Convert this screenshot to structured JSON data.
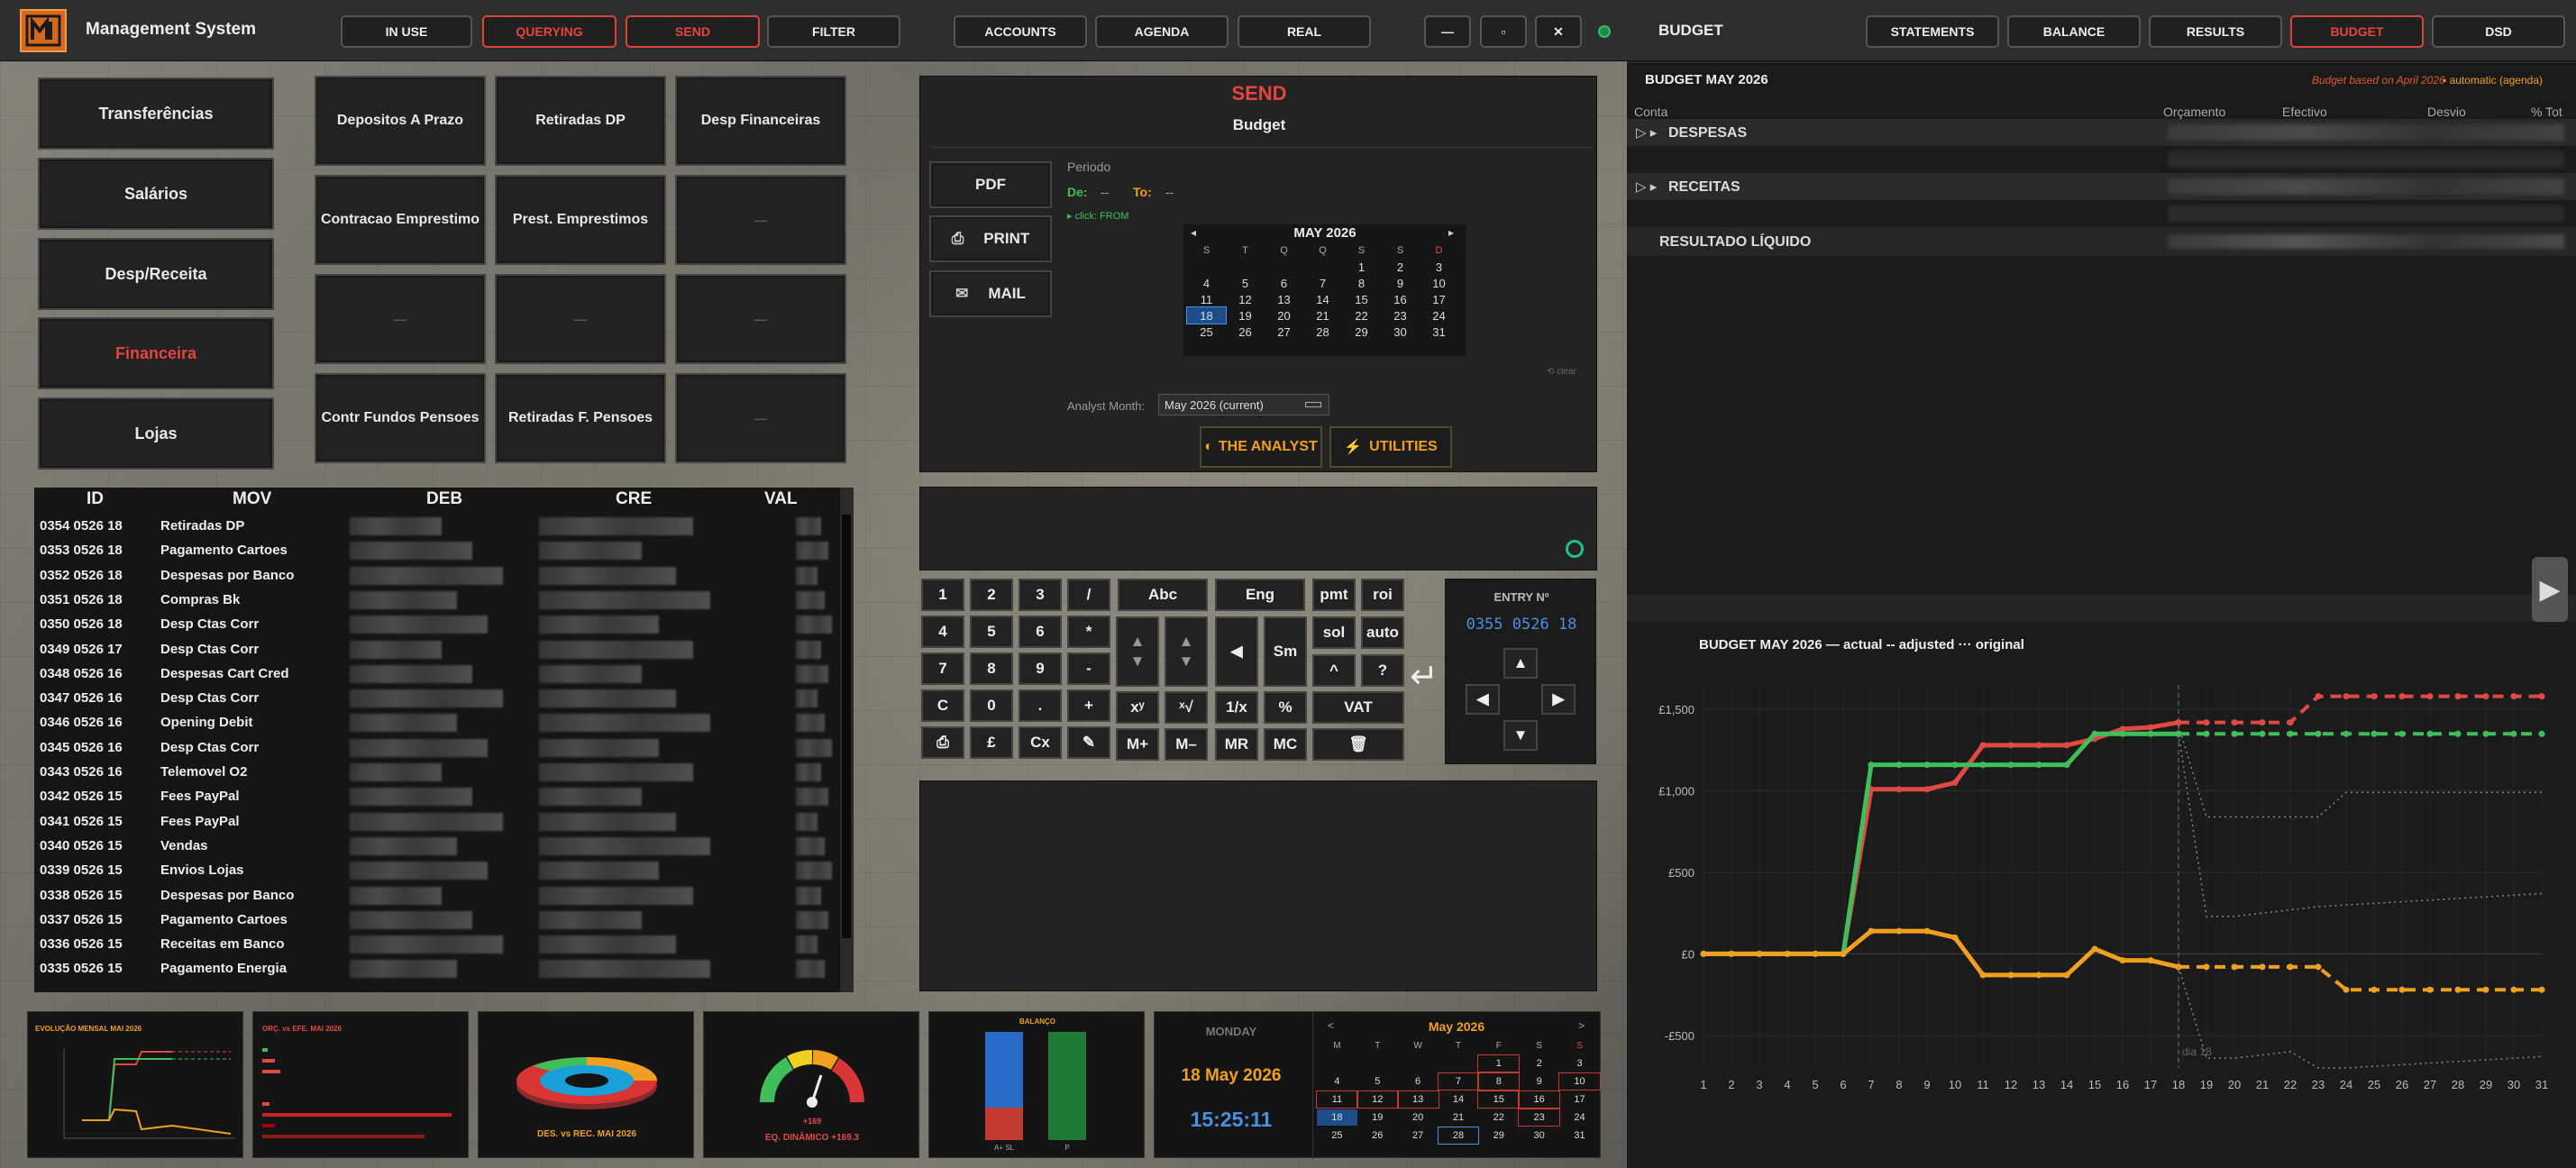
{
  "app": {
    "title": "Management System"
  },
  "toolbar": {
    "buttons": [
      "IN USE",
      "QUERYING",
      "SEND",
      "FILTER",
      "ACCOUNTS",
      "AGENDA",
      "REAL"
    ],
    "active": [
      "QUERYING",
      "SEND"
    ],
    "window": {
      "min": "—",
      "max": "▫",
      "close": "✕"
    }
  },
  "right_nav": {
    "title": "BUDGET",
    "tabs": [
      "STATEMENTS",
      "BALANCE",
      "RESULTS",
      "BUDGET",
      "DSD"
    ],
    "active": "BUDGET"
  },
  "left_menu": [
    "Transferências",
    "Salários",
    "Desp/Receita",
    "Financeira",
    "Lojas"
  ],
  "left_menu_active": "Financeira",
  "grid_tiles": [
    [
      "Depositos A Prazo",
      "Retiradas DP",
      "Desp Financeiras"
    ],
    [
      "Contracao Emprestimo",
      "Prest. Emprestimos",
      "—"
    ],
    [
      "—",
      "—",
      "—"
    ],
    [
      "Contr Fundos Pensoes",
      "Retiradas F. Pensoes",
      "—"
    ]
  ],
  "send": {
    "title": "SEND",
    "subtitle": "Budget",
    "pdf": "PDF",
    "print": "PRINT",
    "mail": "MAIL",
    "periodo_label": "Periodo",
    "de_label": "De:",
    "de_val": "--",
    "to_label": "To:",
    "to_val": "--",
    "hint": "▸ click: FROM",
    "clear": "⟲ clear",
    "analyst_label": "Analyst Month:",
    "analyst_value": "May 2026 (current)",
    "analyst_btn": "THE ANALYST",
    "utilities_btn": "UTILITIES"
  },
  "mini_cal": {
    "title": "MAY 2026",
    "days": [
      "S",
      "T",
      "Q",
      "Q",
      "S",
      "S",
      "D"
    ],
    "weeks": [
      [
        "",
        "",
        "",
        "",
        "1",
        "2",
        "3"
      ],
      [
        "4",
        "5",
        "6",
        "7",
        "8",
        "9",
        "10"
      ],
      [
        "11",
        "12",
        "13",
        "14",
        "15",
        "16",
        "17"
      ],
      [
        "18",
        "19",
        "20",
        "21",
        "22",
        "23",
        "24"
      ],
      [
        "25",
        "26",
        "27",
        "28",
        "29",
        "30",
        "31"
      ]
    ],
    "today": "18"
  },
  "table": {
    "headers": [
      "ID",
      "MOV",
      "DEB",
      "CRE",
      "VAL"
    ],
    "rows": [
      [
        "0354 0526 18",
        "Retiradas DP"
      ],
      [
        "0353 0526 18",
        "Pagamento Cartoes"
      ],
      [
        "0352 0526 18",
        "Despesas por Banco"
      ],
      [
        "0351 0526 18",
        "Compras Bk"
      ],
      [
        "0350 0526 18",
        "Desp Ctas Corr"
      ],
      [
        "0349 0526 17",
        "Desp Ctas Corr"
      ],
      [
        "0348 0526 16",
        "Despesas Cart Cred"
      ],
      [
        "0347 0526 16",
        "Desp Ctas Corr"
      ],
      [
        "0346 0526 16",
        "Opening Debit"
      ],
      [
        "0345 0526 16",
        "Desp Ctas Corr"
      ],
      [
        "0343 0526 16",
        "Telemovel O2"
      ],
      [
        "0342 0526 15",
        "Fees PayPal"
      ],
      [
        "0341 0526 15",
        "Fees PayPal"
      ],
      [
        "0340 0526 15",
        "Vendas"
      ],
      [
        "0339 0526 15",
        "Envios Lojas"
      ],
      [
        "0338 0526 15",
        "Despesas por Banco"
      ],
      [
        "0337 0526 15",
        "Pagamento Cartoes"
      ],
      [
        "0336 0526 15",
        "Receitas em Banco"
      ],
      [
        "0335 0526 15",
        "Pagamento Energia"
      ]
    ]
  },
  "keypad": {
    "rows": [
      [
        "1",
        "2",
        "3",
        "/"
      ],
      [
        "4",
        "5",
        "6",
        "*"
      ],
      [
        "7",
        "8",
        "9",
        "-"
      ],
      [
        "C",
        "0",
        ".",
        "+"
      ],
      [
        "⎙",
        "£",
        "Cx",
        "✎"
      ]
    ],
    "wide": [
      "Abc",
      "Eng"
    ],
    "fn": [
      [
        "pmt",
        "roi"
      ],
      [
        "sol",
        "auto"
      ],
      [
        "^",
        "?"
      ],
      [
        "%",
        ""
      ],
      [
        "MC",
        ""
      ]
    ],
    "misc": [
      "xʸ",
      "ˣ√",
      "1/x",
      "M+",
      "M–",
      "MR",
      "VAT",
      "Sm"
    ],
    "entry_label": "ENTRY Nº",
    "entry_value": "0355 0526 18"
  },
  "budget": {
    "title": "BUDGET  MAY 2026",
    "note": "Budget based on April 2026",
    "mode": "▪ automatic (agenda)",
    "cols": [
      "Conta",
      "Orçamento",
      "Efectivo",
      "Desvio",
      "% Tot"
    ],
    "rows": [
      "DESPESAS",
      "RECEITAS"
    ],
    "total": "RESULTADO LÍQUIDO"
  },
  "chart_data": {
    "type": "line",
    "title": "BUDGET  MAY 2026",
    "legend": [
      "— actual",
      "-- adjusted",
      "··· original"
    ],
    "x": [
      1,
      2,
      3,
      4,
      5,
      6,
      7,
      8,
      9,
      10,
      11,
      12,
      13,
      14,
      15,
      16,
      17,
      18,
      19,
      20,
      21,
      22,
      23,
      24,
      25,
      26,
      27,
      28,
      29,
      30,
      31
    ],
    "yticks": [
      "£1,500",
      "£1,000",
      "£500",
      "£0",
      "-£500"
    ],
    "ylim": [
      -700,
      1650
    ],
    "marker_label": "dia 18",
    "series": [
      {
        "name": "actual",
        "color": "#e04a45",
        "values": [
          0,
          0,
          0,
          0,
          0,
          0,
          1010,
          1010,
          1010,
          1050,
          1280,
          1280,
          1280,
          1280,
          1320,
          1380,
          1390,
          1420
        ]
      },
      {
        "name": "actual",
        "color": "#3fbf5a",
        "values": [
          0,
          0,
          0,
          0,
          0,
          0,
          1160,
          1160,
          1160,
          1160,
          1160,
          1160,
          1160,
          1160,
          1350,
          1350,
          1350,
          1350
        ]
      },
      {
        "name": "actual",
        "color": "#f0a020",
        "values": [
          0,
          0,
          0,
          0,
          0,
          0,
          140,
          140,
          140,
          100,
          -130,
          -130,
          -130,
          -130,
          30,
          -40,
          -40,
          -80
        ]
      },
      {
        "name": "adjusted",
        "color": "#e04a45",
        "x0": 18,
        "values": [
          1420,
          1420,
          1420,
          1420,
          1420,
          1580,
          1580,
          1580,
          1580,
          1580,
          1580,
          1580,
          1580,
          1580
        ]
      },
      {
        "name": "adjusted",
        "color": "#3fbf5a",
        "x0": 18,
        "values": [
          1350,
          1350,
          1350,
          1350,
          1350,
          1350,
          1350,
          1350,
          1350,
          1350,
          1350,
          1350,
          1350,
          1350
        ]
      },
      {
        "name": "adjusted",
        "color": "#f0a020",
        "x0": 18,
        "values": [
          -80,
          -80,
          -80,
          -80,
          -80,
          -80,
          -220,
          -220,
          -220,
          -220,
          -220,
          -220,
          -220,
          -220
        ]
      },
      {
        "name": "original",
        "color": "#888",
        "x0": 18,
        "values": [
          1400,
          840,
          840,
          840,
          840,
          840,
          990,
          990,
          990,
          990,
          990,
          990,
          990,
          990
        ]
      },
      {
        "name": "original",
        "color": "#888",
        "x0": 18,
        "values": [
          1350,
          230,
          230,
          250,
          270,
          290,
          300,
          310,
          320,
          330,
          340,
          350,
          360,
          370
        ]
      },
      {
        "name": "original",
        "color": "#888",
        "x0": 18,
        "values": [
          -80,
          -640,
          -640,
          -620,
          -600,
          -700,
          -700,
          -690,
          -680,
          -670,
          -660,
          -650,
          -640,
          -630
        ]
      }
    ]
  },
  "bottom": {
    "p1": "EVOLUÇÃO MENSAL  MAI 2026",
    "p2": "ORÇ. vs EFE.  MAI 2026",
    "p3": "DES. vs REC.  MAI 2026",
    "p4": "EQ. DINÂMICO  +169.3",
    "p4_val": "+169",
    "p5": "BALANÇO",
    "p5_a": "A+ SL",
    "p5_b": "P",
    "day": "MONDAY",
    "date": "18 May 2026",
    "time": "15:25:11",
    "cal_title": "May 2026",
    "cal_days": [
      "M",
      "T",
      "W",
      "T",
      "F",
      "S",
      "S"
    ],
    "cal_weeks": [
      [
        "",
        "",
        "",
        "",
        "1",
        "2",
        "3"
      ],
      [
        "4",
        "5",
        "6",
        "7",
        "8",
        "9",
        "10"
      ],
      [
        "11",
        "12",
        "13",
        "14",
        "15",
        "16",
        "17"
      ],
      [
        "18",
        "19",
        "20",
        "21",
        "22",
        "23",
        "24"
      ],
      [
        "25",
        "26",
        "27",
        "28",
        "29",
        "30",
        "31"
      ]
    ]
  }
}
